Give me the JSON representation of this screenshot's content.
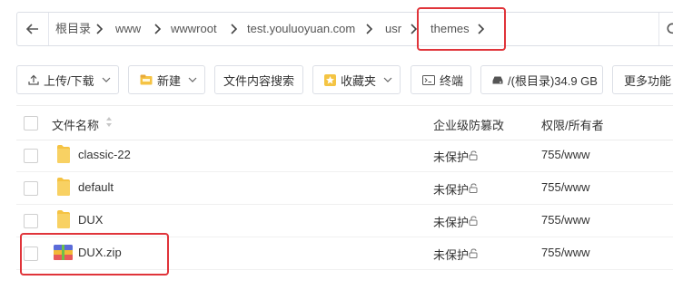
{
  "breadcrumb": {
    "items": [
      "根目录",
      "www",
      "wwwroot",
      "test.youluoyuan.com",
      "usr",
      "themes"
    ]
  },
  "toolbar": {
    "upload_label": "上传/下载",
    "new_label": "新建",
    "search_label": "文件内容搜索",
    "favorites_label": "收藏夹",
    "terminal_label": "终端",
    "disk_label": "/(根目录)34.9 GB",
    "more_label": "更多功能"
  },
  "table": {
    "headers": {
      "name": "文件名称",
      "protect": "企业级防篡改",
      "perm": "权限/所有者"
    },
    "rows": [
      {
        "name": "classic-22",
        "type": "folder",
        "protect": "未保护",
        "perm": "755/www"
      },
      {
        "name": "default",
        "type": "folder",
        "protect": "未保护",
        "perm": "755/www"
      },
      {
        "name": "DUX",
        "type": "folder",
        "protect": "未保护",
        "perm": "755/www"
      },
      {
        "name": "DUX.zip",
        "type": "zip",
        "protect": "未保护",
        "perm": "755/www"
      }
    ]
  },
  "colors": {
    "highlight": "#e0343a",
    "folder": "#f5c343",
    "accent": "#20a53a"
  }
}
